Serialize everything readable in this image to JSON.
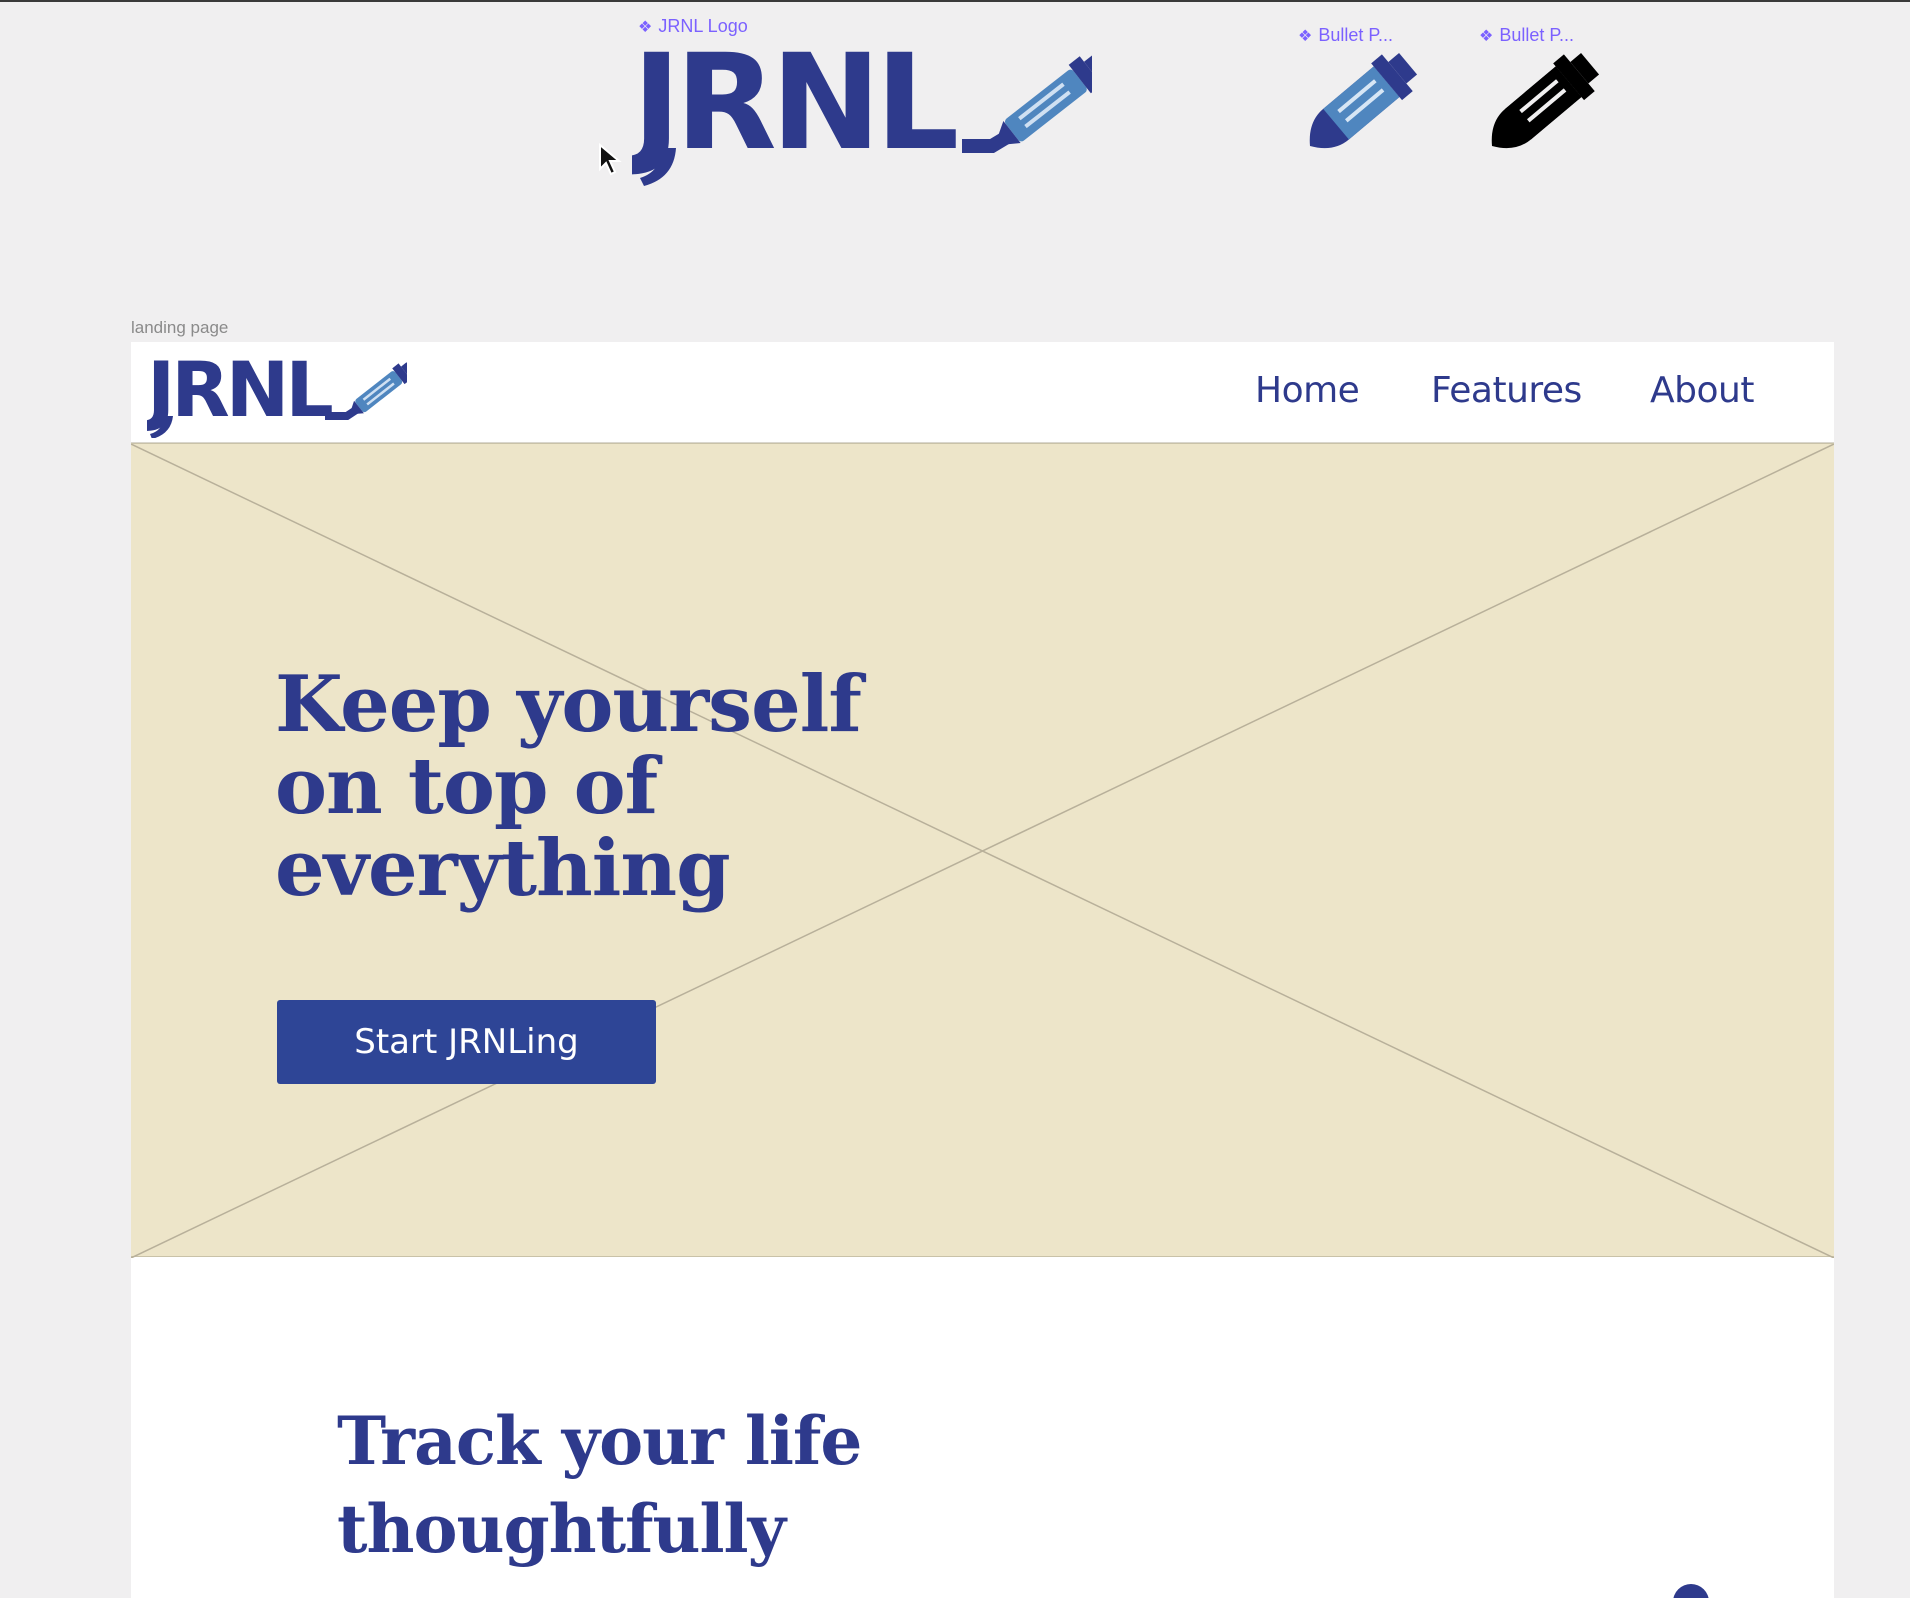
{
  "canvas": {
    "components": [
      {
        "label": "JRNL Logo",
        "icon": "component-icon"
      },
      {
        "label": "Bullet P...",
        "icon": "component-icon"
      },
      {
        "label": "Bullet P...",
        "icon": "component-icon"
      }
    ],
    "logo_text": "JRNL",
    "frame_label": "landing page"
  },
  "navbar": {
    "logo_text": "JRNL",
    "links": [
      "Home",
      "Features",
      "About"
    ]
  },
  "hero": {
    "title_lines": [
      "Keep yourself",
      "on top of",
      "everything"
    ],
    "cta_label": "Start JRNLing",
    "placeholder_icon": "image-placeholder-x"
  },
  "section": {
    "title_lines": [
      "Track your life",
      "thoughtfully"
    ]
  },
  "colors": {
    "brand_navy": "#2e3a8c",
    "button_blue": "#2e4596",
    "pen_light_blue": "#4f86bf",
    "hero_bg": "#ede5c9",
    "canvas_bg": "#f0eff0",
    "component_purple": "#7b61ff"
  }
}
